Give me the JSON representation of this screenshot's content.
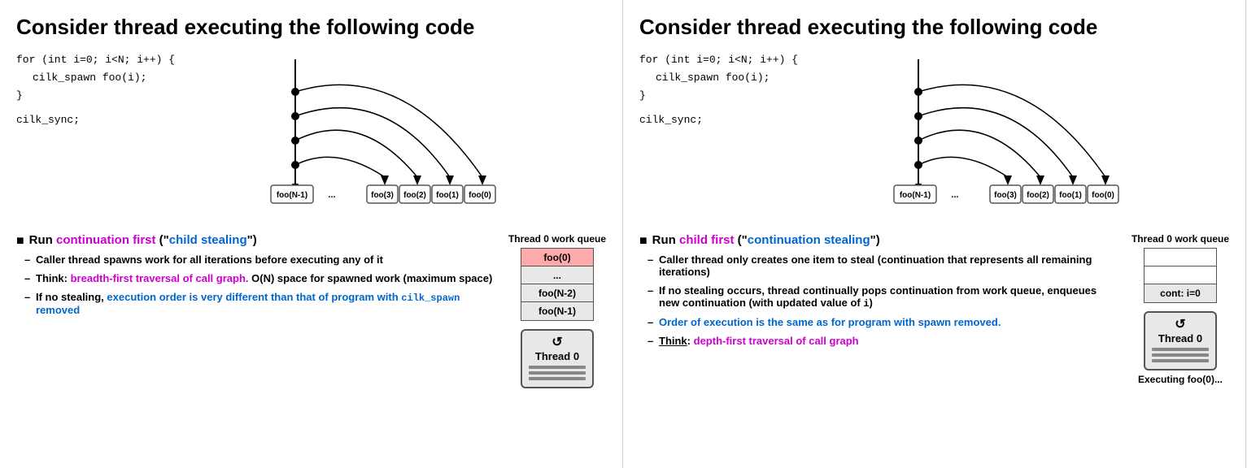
{
  "panel1": {
    "title": "Consider thread executing the following code",
    "code": [
      "for (int i=0; i<N; i++) {",
      "  cilk_spawn foo(i);",
      "}",
      "cilk_sync;"
    ],
    "dag_nodes": [
      "foo(N-1)",
      "...",
      "foo(3)",
      "foo(2)",
      "foo(1)",
      "foo(0)"
    ],
    "main_bullet": "Run ",
    "main_bullet_purple": "continuation first",
    "main_bullet_rest": " (\"",
    "main_bullet_blue": "child stealing",
    "main_bullet_end": "\")",
    "sub_bullets": [
      {
        "text": "Caller thread spawns work for all iterations before executing any of it",
        "color": "black"
      },
      {
        "text_before": "Think: ",
        "text_purple": "breadth-first traversal of call graph.",
        "text_after": " O(N) space for spawned work (maximum space)",
        "color": "purple"
      },
      {
        "text_before": "If no stealing, ",
        "text_blue": "execution order is very different than that of program with ",
        "text_code": "cilk_spawn",
        "text_blue2": " removed",
        "color": "blue"
      }
    ],
    "queue_title": "Thread 0 work queue",
    "queue_cells": [
      "foo(0)",
      "...",
      "foo(N-2)",
      "foo(N-1)"
    ],
    "queue_cell_colors": [
      "red-bg",
      "light-gray",
      "light-gray",
      "light-gray"
    ],
    "thread_label": "Thread 0"
  },
  "panel2": {
    "title": "Consider thread executing the following code",
    "code": [
      "for (int i=0; i<N; i++) {",
      "  cilk_spawn foo(i);",
      "}",
      "cilk_sync;"
    ],
    "dag_nodes": [
      "foo(N-1)",
      "...",
      "foo(3)",
      "foo(2)",
      "foo(1)",
      "foo(0)"
    ],
    "main_bullet": "Run ",
    "main_bullet_purple": "child first",
    "main_bullet_rest": " (\"",
    "main_bullet_blue": "continuation stealing",
    "main_bullet_end": "\")",
    "sub_bullets": [
      {
        "text": "Caller thread only creates one item to steal (continuation that represents all remaining iterations)",
        "color": "black"
      },
      {
        "text": "If no stealing occurs, thread continually pops continuation from work queue, enqueues new continuation (with updated value of i)",
        "text_code": "i",
        "color": "black"
      },
      {
        "text_blue": "Order of execution is the same as for program with spawn removed.",
        "color": "blue"
      },
      {
        "text_before": "Think: ",
        "text_purple": "depth-first traversal of call graph",
        "color": "purple"
      }
    ],
    "queue_title": "Thread 0 work queue",
    "queue_cells": [
      "",
      "",
      "cont: i=0"
    ],
    "queue_cell_colors": [
      "empty",
      "empty",
      "light-gray"
    ],
    "thread_label": "Thread 0",
    "executing_label": "Executing foo(0)..."
  }
}
